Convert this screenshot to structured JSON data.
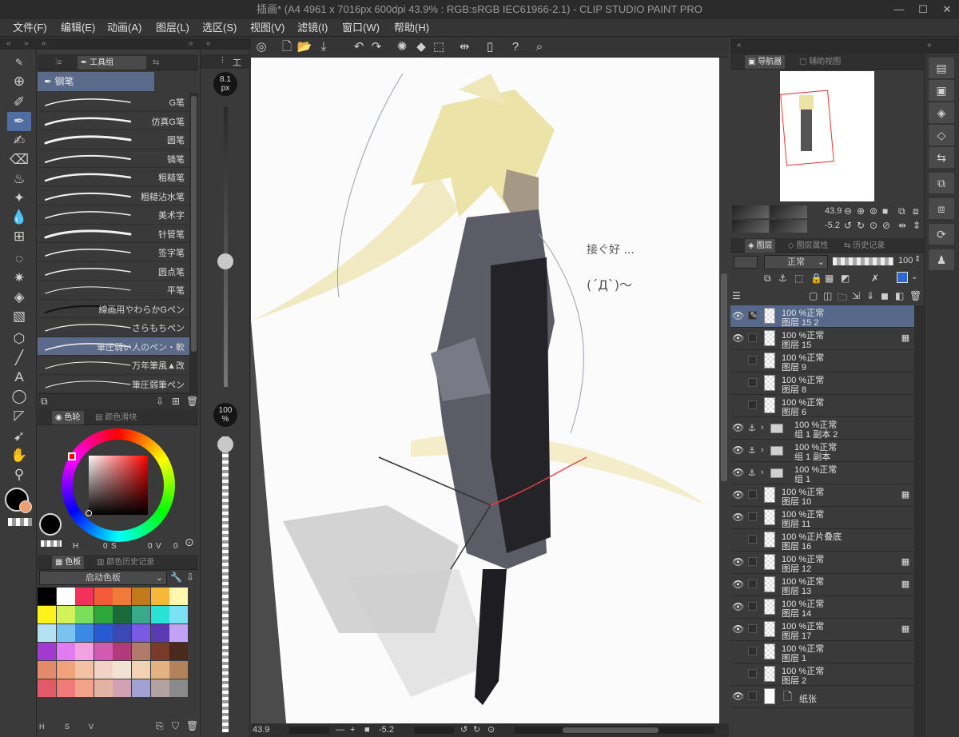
{
  "window": {
    "title": "插画* (A4 4961 x 7016px 600dpi 43.9% : RGB:sRGB IEC61966-2.1)  - CLIP STUDIO PAINT PRO",
    "minimize": "—",
    "maximize": "☐",
    "close": "✕"
  },
  "menu": [
    "文件(F)",
    "编辑(E)",
    "动画(A)",
    "图层(L)",
    "选区(S)",
    "视图(V)",
    "滤镜(I)",
    "窗口(W)",
    "帮助(H)"
  ],
  "subtool_panel": {
    "tab_label": "工具组",
    "group_label": "钢笔",
    "brushes": [
      "G笔",
      "仿真G笔",
      "圆笔",
      "镝笔",
      "粗糙笔",
      "粗糙沾水笔",
      "美术字",
      "针管笔",
      "签字笔",
      "圆点笔",
      "平笔",
      "線画用やわらかGペン",
      "さらもちペン",
      "筆圧弱い人のペン・軟",
      "万年筆風▲改",
      "筆圧弱筆ペン"
    ],
    "selected_brush_index": 13
  },
  "size_column": {
    "tab_label": "工",
    "brush_size": "8.1\npx",
    "opacity": "100\n%",
    "brush_size_slider_fraction": 0.55,
    "opacity_slider_fraction": 0.0
  },
  "color_panel": {
    "tab_wheel": "色轮",
    "tab_slider": "颜色滑块",
    "h_label": "H",
    "h_value": "0",
    "s_label": "S",
    "s_value": "0",
    "v_label": "V",
    "v_value": "0",
    "main_color": "#000000",
    "sub_color": "#f0a070"
  },
  "palette_panel": {
    "tab_palette": "色板",
    "tab_history": "颜色历史记录",
    "palette_name": "启动色板",
    "footer": [
      "H",
      "S",
      "V"
    ],
    "swatches": [
      "#000000",
      "#ffffff",
      "#f2325a",
      "#f25a3a",
      "#f07a3a",
      "#c07a1a",
      "#f6b83a",
      "#fff6b0",
      "#fff21a",
      "#d2f25a",
      "#7ade5a",
      "#2ea83a",
      "#1a6a3a",
      "#3aa88a",
      "#2ae2d2",
      "#7ae2f2",
      "#b2e2f2",
      "#7ac2f2",
      "#3a8ae2",
      "#2a5ad2",
      "#3a4ab2",
      "#7a5ae2",
      "#5a3ab2",
      "#c2a2f2",
      "#a23ad2",
      "#e27af2",
      "#f2a2e2",
      "#d25ab2",
      "#b23a7a",
      "#b27a6a",
      "#7a3a2a",
      "#4a2a1a",
      "#e28a6a",
      "#f2a27a",
      "#f2c2a2",
      "#f2d2c2",
      "#f2e2d2",
      "#f2d2b2",
      "#e2b282",
      "#b2825a",
      "#e25a6a",
      "#f27a7a",
      "#f2a28a",
      "#e2b2a2",
      "#d2a2b2",
      "#a2a2d2",
      "#b2a2a2",
      "#8a8a8a"
    ]
  },
  "canvas": {
    "status_zoom": "43.9",
    "status_angle": "-5.2",
    "annotation_1": "接ぐ好 ...",
    "annotation_2": "(´Д`)〜"
  },
  "navigator": {
    "tab_navigator": "导航器",
    "tab_sub": "辅助视图",
    "zoom": "43.9",
    "angle": "-5.2"
  },
  "layer_panel": {
    "tab_layer": "图层",
    "tab_property": "图层属性",
    "tab_history": "历史记录",
    "blend_mode": "正常",
    "opacity": "100",
    "layers": [
      {
        "line1": "100 %正常",
        "line2": "图层 15 2",
        "visible": true,
        "selected": true,
        "type": "raster",
        "tag": "✎"
      },
      {
        "line1": "100 %正常",
        "line2": "图层 15",
        "visible": true,
        "selected": false,
        "type": "raster",
        "tag": "▦"
      },
      {
        "line1": "100 %正常",
        "line2": "图层 9",
        "visible": false,
        "selected": false,
        "type": "raster",
        "tag": ""
      },
      {
        "line1": "100 %正常",
        "line2": "图层 8",
        "visible": false,
        "selected": false,
        "type": "raster",
        "tag": ""
      },
      {
        "line1": "100 %正常",
        "line2": "图层 6",
        "visible": false,
        "selected": false,
        "type": "raster",
        "tag": ""
      },
      {
        "line1": "100 %正常",
        "line2": "组 1 副本 2",
        "visible": true,
        "selected": false,
        "type": "folder",
        "tag": ""
      },
      {
        "line1": "100 %正常",
        "line2": "组 1 副本",
        "visible": true,
        "selected": false,
        "type": "folder",
        "tag": ""
      },
      {
        "line1": "100 %正常",
        "line2": "组 1",
        "visible": true,
        "selected": false,
        "type": "folder",
        "tag": ""
      },
      {
        "line1": "100 %正常",
        "line2": "图层 10",
        "visible": true,
        "selected": false,
        "type": "raster",
        "tag": "▦"
      },
      {
        "line1": "100 %正常",
        "line2": "图层 11",
        "visible": true,
        "selected": false,
        "type": "raster",
        "tag": ""
      },
      {
        "line1": "100 %正片叠底",
        "line2": "图层 16",
        "visible": false,
        "selected": false,
        "type": "raster",
        "tag": ""
      },
      {
        "line1": "100 %正常",
        "line2": "图层 12",
        "visible": true,
        "selected": false,
        "type": "raster",
        "tag": "▦"
      },
      {
        "line1": "100 %正常",
        "line2": "图层 13",
        "visible": true,
        "selected": false,
        "type": "raster",
        "tag": "▦"
      },
      {
        "line1": "100 %正常",
        "line2": "图层 14",
        "visible": true,
        "selected": false,
        "type": "raster",
        "tag": ""
      },
      {
        "line1": "100 %正常",
        "line2": "图层 17",
        "visible": true,
        "selected": false,
        "type": "raster",
        "tag": "▦"
      },
      {
        "line1": "100 %正常",
        "line2": "图层 1",
        "visible": false,
        "selected": false,
        "type": "raster",
        "tag": ""
      },
      {
        "line1": "100 %正常",
        "line2": "图层 2",
        "visible": false,
        "selected": false,
        "type": "raster",
        "tag": ""
      },
      {
        "line1": "",
        "line2": "纸张",
        "visible": true,
        "selected": false,
        "type": "paper",
        "tag": ""
      }
    ]
  }
}
